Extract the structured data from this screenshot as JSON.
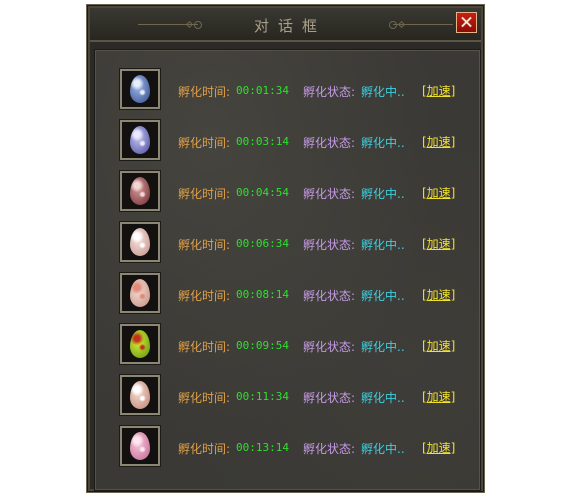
{
  "dialog": {
    "title": "对话框"
  },
  "eggs": [
    {
      "time_label": "孵化时间:",
      "time": "00:01:34",
      "state_label": "孵化状态:",
      "state": "孵化中..",
      "speed_label": "[加速]",
      "color_light": "#9fb6e6",
      "color_dark": "#2f4b8c",
      "color_spot": "#e8eefc"
    },
    {
      "time_label": "孵化时间:",
      "time": "00:03:14",
      "state_label": "孵化状态:",
      "state": "孵化中..",
      "speed_label": "[加速]",
      "color_light": "#c2c4f0",
      "color_dark": "#4a4a9e",
      "color_spot": "#eceaff"
    },
    {
      "time_label": "孵化时间:",
      "time": "00:04:54",
      "state_label": "孵化状态:",
      "state": "孵化中..",
      "speed_label": "[加速]",
      "color_light": "#d49a9a",
      "color_dark": "#6e2a2e",
      "color_spot": "#f4d6d6"
    },
    {
      "time_label": "孵化时间:",
      "time": "00:06:34",
      "state_label": "孵化状态:",
      "state": "孵化中..",
      "speed_label": "[加速]",
      "color_light": "#f6e2dc",
      "color_dark": "#c29088",
      "color_spot": "#ffffff"
    },
    {
      "time_label": "孵化时间:",
      "time": "00:08:14",
      "state_label": "孵化状态:",
      "state": "孵化中..",
      "speed_label": "[加速]",
      "color_light": "#f4ded6",
      "color_dark": "#c48a7c",
      "color_spot": "#e08a78"
    },
    {
      "time_label": "孵化时间:",
      "time": "00:09:54",
      "state_label": "孵化状态:",
      "state": "孵化中..",
      "speed_label": "[加速]",
      "color_light": "#d8f038",
      "color_dark": "#5e8e10",
      "color_spot": "#c0321a"
    },
    {
      "time_label": "孵化时间:",
      "time": "00:11:34",
      "state_label": "孵化状态:",
      "state": "孵化中..",
      "speed_label": "[加速]",
      "color_light": "#f2dcd2",
      "color_dark": "#c0806e",
      "color_spot": "#ffffff"
    },
    {
      "time_label": "孵化时间:",
      "time": "00:13:14",
      "state_label": "孵化状态:",
      "state": "孵化中..",
      "speed_label": "[加速]",
      "color_light": "#f6c8dc",
      "color_dark": "#c0648c",
      "color_spot": "#ffe6f0"
    }
  ]
}
